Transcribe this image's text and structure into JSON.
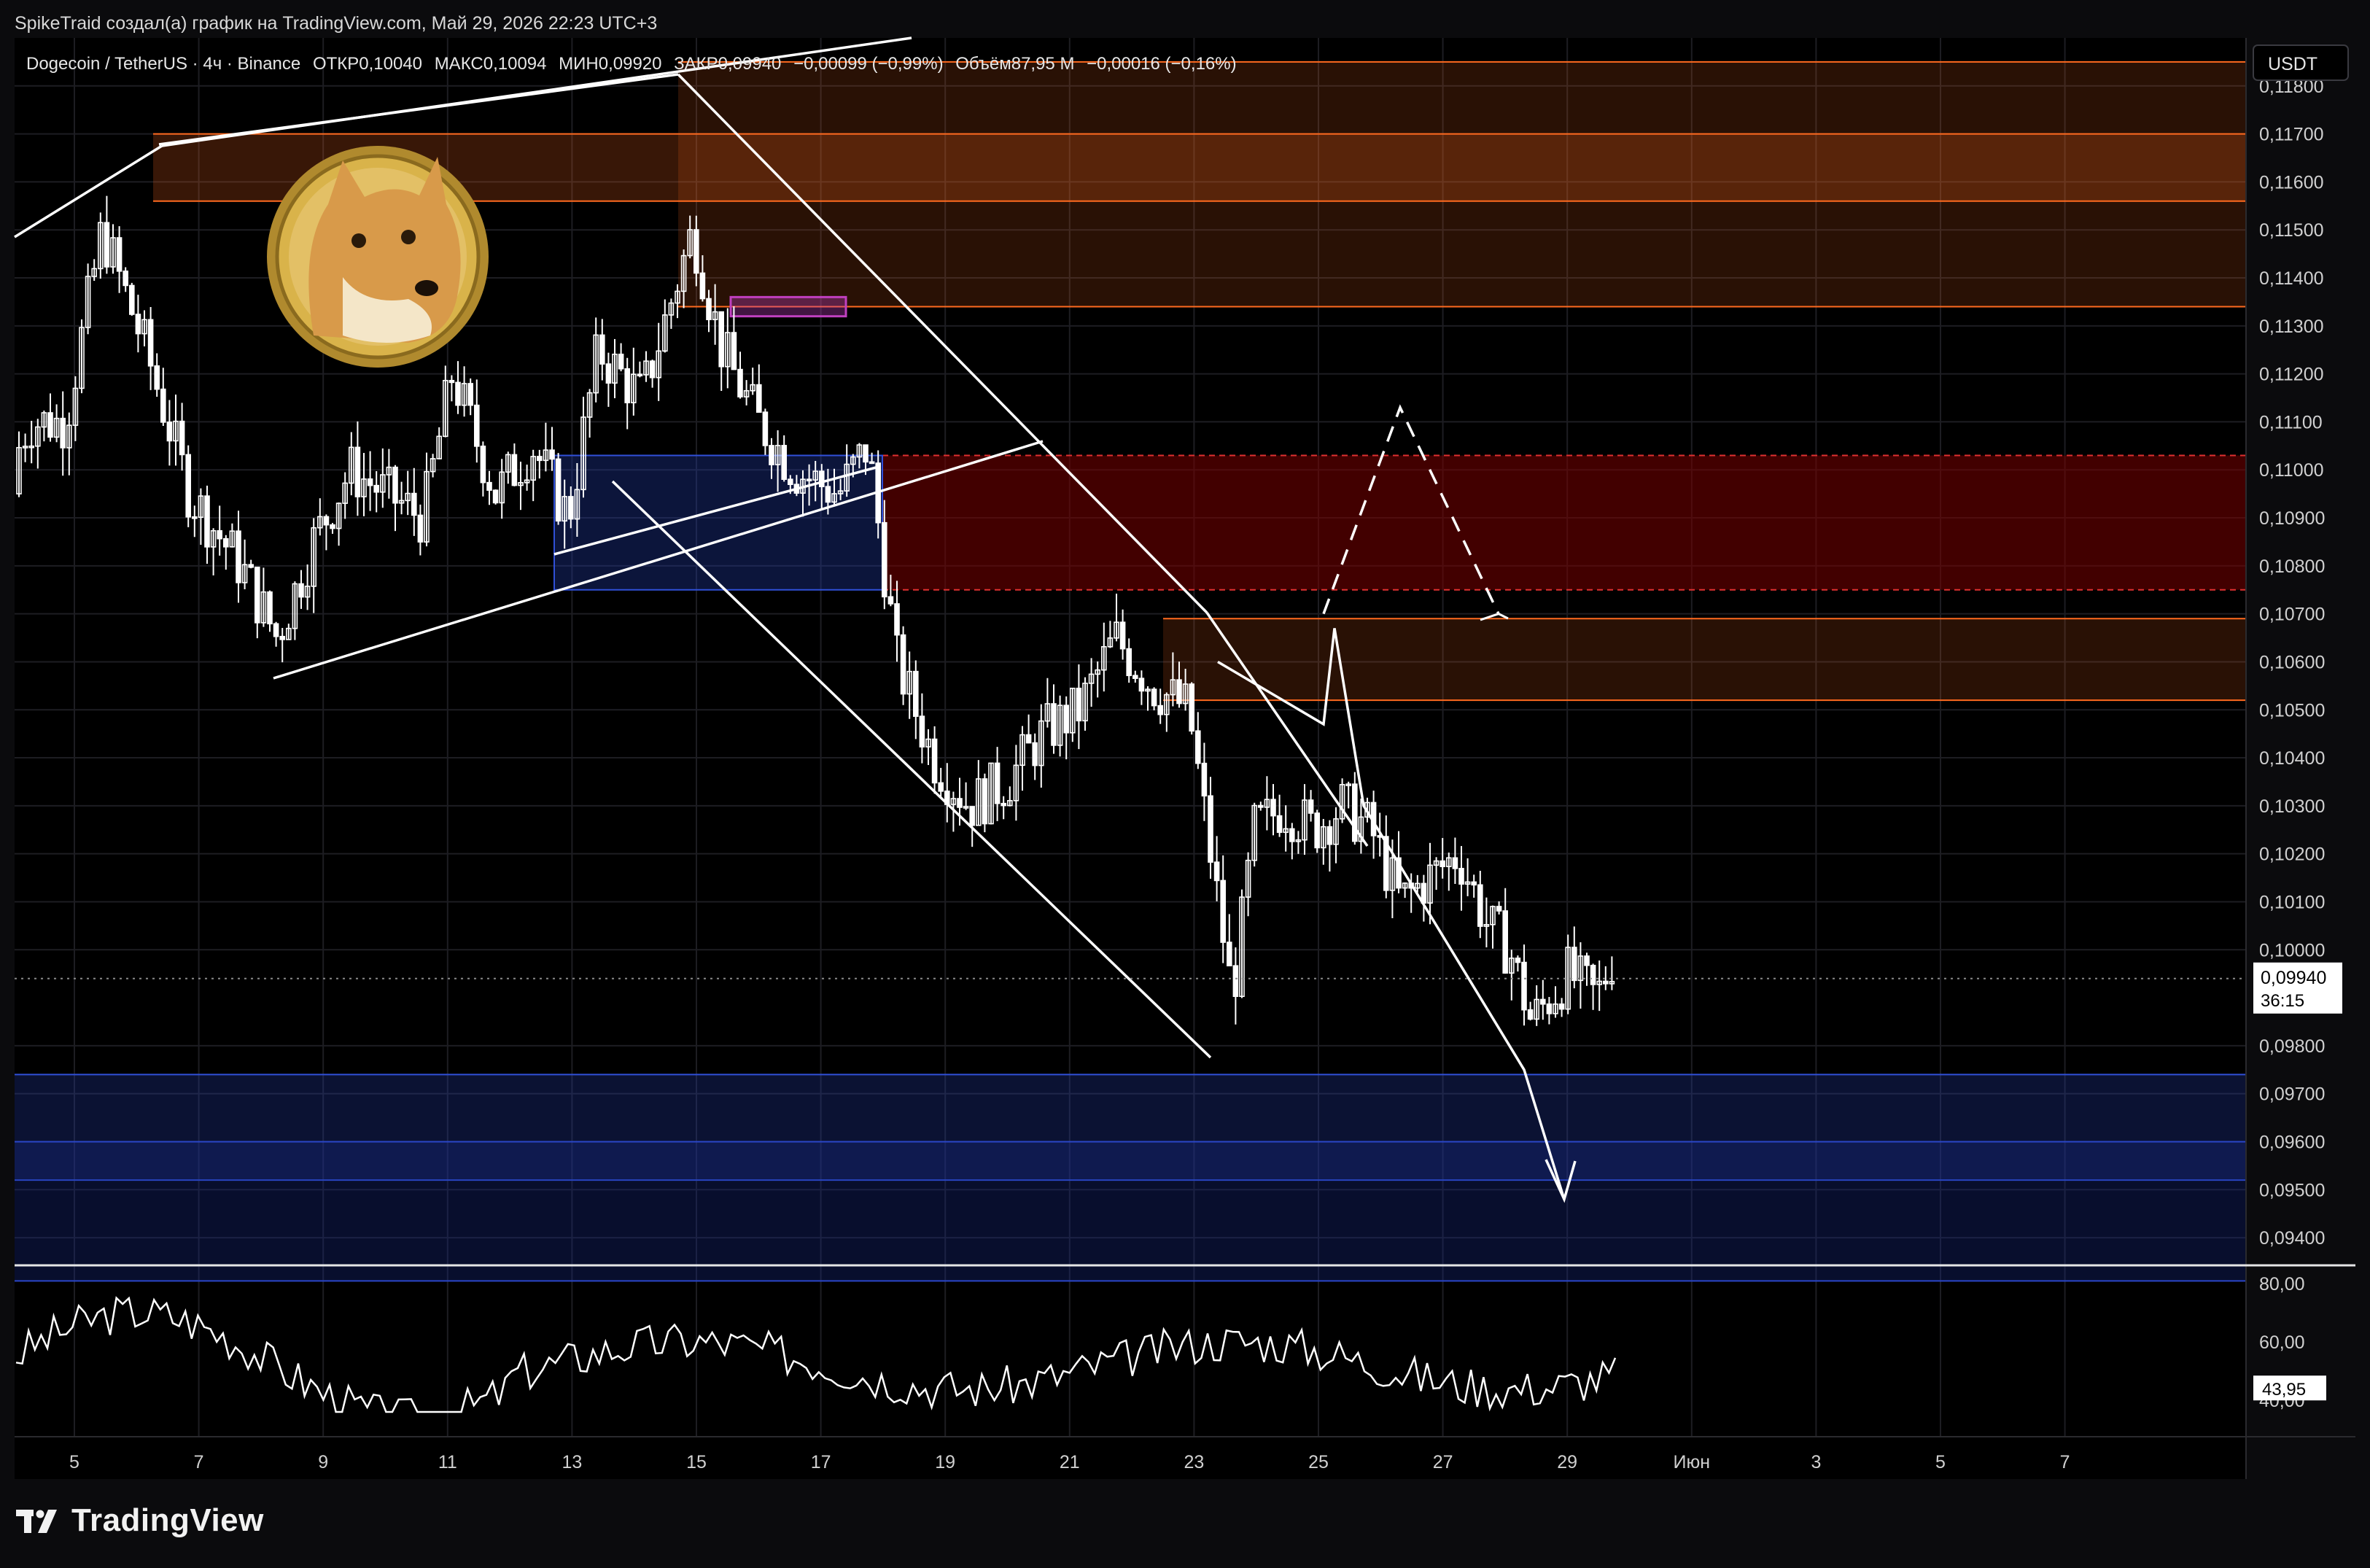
{
  "credit": "SpikeTraid создал(а) график на TradingView.com, Май 29, 2026 22:23 UTC+3",
  "legend": {
    "symbol": "Dogecoin / TetherUS · 4ч · Binance",
    "open": "ОТКР0,10040",
    "high": "МАКС0,10094",
    "low": "МИН0,09920",
    "close": "ЗАКР0,09940",
    "change": "−0,00099 (−0,99%)",
    "volume": "Объём87,95 M",
    "volume_change": "−0,00016 (−0,16%)"
  },
  "brand": "TradingView",
  "colors": {
    "background": "#000000",
    "candle": "#ffffff",
    "resistance_zone": "#ff6a1f",
    "supply_zone": "#8b0000",
    "support_zone": "#1a3aa8",
    "order_block": "#c040c0"
  },
  "chart_data": {
    "type": "candlestick",
    "currency": "USDT",
    "last_price": "0,09940",
    "countdown": "36:15",
    "rsi_value": "43,95",
    "ylim": [
      0.0935,
      0.119
    ],
    "y_ticks": [
      "0,11800",
      "0,11700",
      "0,11600",
      "0,11500",
      "0,11400",
      "0,11300",
      "0,11200",
      "0,11100",
      "0,11000",
      "0,10900",
      "0,10800",
      "0,10700",
      "0,10600",
      "0,10500",
      "0,10400",
      "0,10300",
      "0,10200",
      "0,10100",
      "0,10000",
      "0,09800",
      "0,09700",
      "0,09600",
      "0,09500",
      "0,09400"
    ],
    "x_ticks": [
      "5",
      "7",
      "9",
      "11",
      "13",
      "15",
      "17",
      "19",
      "21",
      "23",
      "25",
      "27",
      "29",
      "Июн",
      "3",
      "5",
      "7"
    ],
    "rsi_ticks": [
      "80,00",
      "60,00",
      "40,00"
    ],
    "zones": [
      {
        "kind": "resistance",
        "from": 0.1134,
        "to": 0.1185
      },
      {
        "kind": "resistance-strong",
        "from": 0.1156,
        "to": 0.117
      },
      {
        "kind": "supply",
        "from": 0.1075,
        "to": 0.1103
      },
      {
        "kind": "resistance",
        "from": 0.1052,
        "to": 0.1069
      },
      {
        "kind": "support",
        "from": 0.0952,
        "to": 0.0974
      },
      {
        "kind": "support-deep",
        "from": 0.0931,
        "to": 0.096
      }
    ],
    "path_projection": [
      0.106,
      0.1047,
      0.1067,
      0.103,
      0.0975,
      0.0948
    ],
    "path_scenario": [
      0.107,
      0.1113,
      0.107
    ]
  }
}
